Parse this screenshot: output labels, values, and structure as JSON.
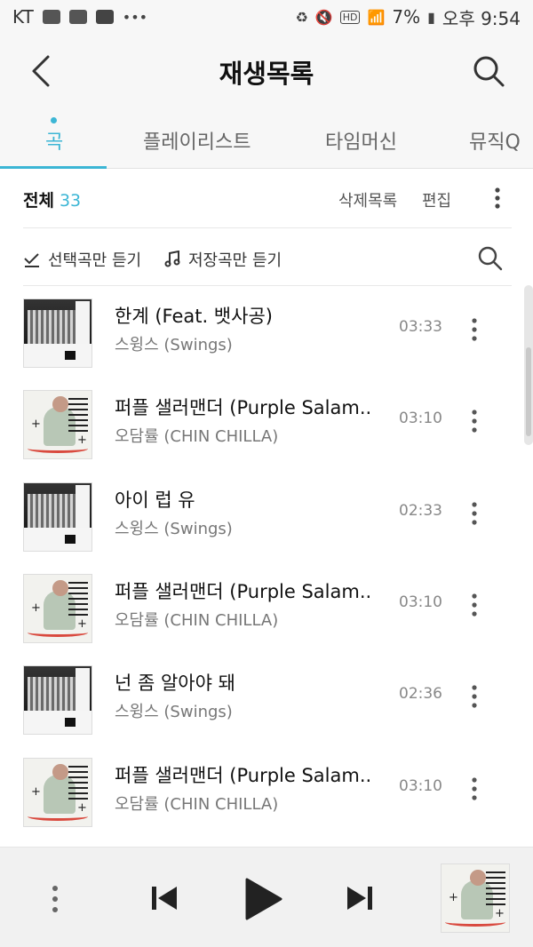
{
  "status_bar": {
    "carrier": "KT",
    "battery": "7%",
    "time": "오후 9:54"
  },
  "header": {
    "title": "재생목록"
  },
  "tabs": [
    {
      "label": "곡",
      "active": true
    },
    {
      "label": "플레이리스트",
      "active": false
    },
    {
      "label": "타임머신",
      "active": false
    },
    {
      "label": "뮤직Q",
      "active": false
    }
  ],
  "list_toolbar": {
    "total_label": "전체",
    "total_count": "33",
    "deleted_list": "삭제목록",
    "edit": "편집",
    "listen_selected": "선택곡만 듣기",
    "listen_saved": "저장곡만 듣기"
  },
  "songs": [
    {
      "title": "한계 (Feat. 뱃사공)",
      "artist": "스윙스 (Swings)",
      "duration": "03:33",
      "art": "upgrade-iv"
    },
    {
      "title": "퍼플 샐러맨더 (Purple Salam..",
      "artist": "오담률 (CHIN CHILLA)",
      "duration": "03:10",
      "art": "purple-salamander"
    },
    {
      "title": "아이 럽 유",
      "artist": "스윙스 (Swings)",
      "duration": "02:33",
      "art": "upgrade-iv"
    },
    {
      "title": "퍼플 샐러맨더 (Purple Salam..",
      "artist": "오담률 (CHIN CHILLA)",
      "duration": "03:10",
      "art": "purple-salamander"
    },
    {
      "title": "넌 좀 알아야 돼",
      "artist": "스윙스 (Swings)",
      "duration": "02:36",
      "art": "upgrade-iv"
    },
    {
      "title": "퍼플 샐러맨더 (Purple Salam..",
      "artist": "오담률 (CHIN CHILLA)",
      "duration": "03:10",
      "art": "purple-salamander"
    }
  ],
  "colors": {
    "accent": "#3cb6d5",
    "text": "#111111",
    "subtext": "#777777"
  }
}
